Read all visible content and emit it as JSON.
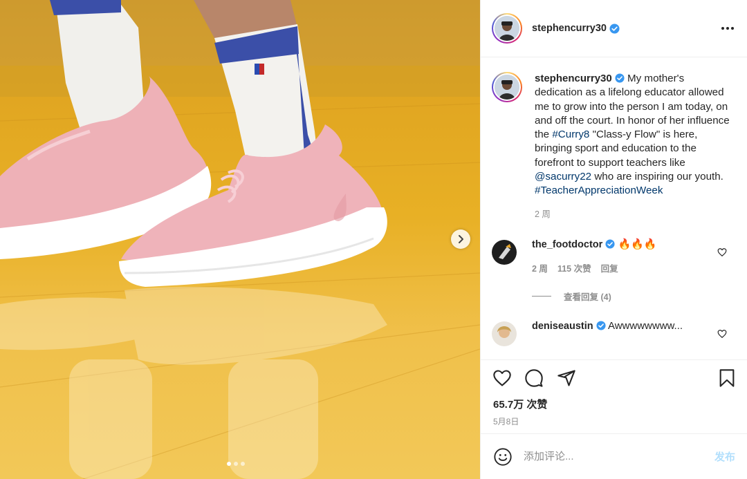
{
  "author": {
    "username": "stephencurry30",
    "verified": true
  },
  "caption": {
    "text_before": "My mother's dedication as a lifelong educator allowed me to grow into the person I am today, on and off the court. In honor of her influence the ",
    "tag1": "#Curry8",
    "text_middle": " \"Class-y Flow\" is here, bringing sport and education to the forefront to support teachers like ",
    "mention": "@sacurry22",
    "text_after": " who are inspiring our youth. ",
    "tag2": "#TeacherAppreciationWeek",
    "time": "2 周"
  },
  "comments": [
    {
      "username": "the_footdoctor",
      "verified": true,
      "text": "🔥🔥🔥",
      "time": "2 周",
      "likes": "115 次赞",
      "reply_label": "回复",
      "view_replies": "查看回复 (4)"
    },
    {
      "username": "deniseaustin",
      "verified": true,
      "text": "Awwwwwwww..."
    }
  ],
  "stats": {
    "likes": "65.7万 次赞",
    "date": "5月8日"
  },
  "composer": {
    "placeholder": "添加评论...",
    "post_label": "发布"
  },
  "carousel": {
    "slides": 3,
    "active": 1
  },
  "colors": {
    "link": "#00376b",
    "verified": "#3897f0",
    "post_button": "#b2dffc",
    "muted": "#8e8e8e"
  },
  "icons": [
    "chevron-right-icon",
    "more-icon",
    "verified-icon",
    "heart-icon",
    "comment-icon",
    "share-icon",
    "bookmark-icon",
    "emoji-icon"
  ]
}
